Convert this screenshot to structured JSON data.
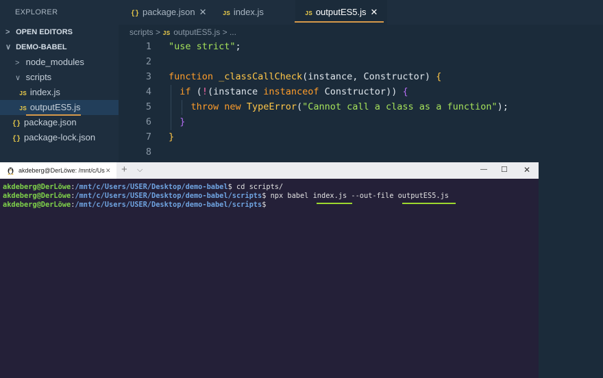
{
  "explorer": {
    "title": "EXPLORER",
    "open_editors": "OPEN EDITORS",
    "project": "DEMO-BABEL",
    "items": [
      {
        "label": "node_modules",
        "icon": "chevron-right-icon"
      },
      {
        "label": "scripts",
        "icon": "chevron-down-icon"
      },
      {
        "label": "index.js",
        "icon": "js-file-icon"
      },
      {
        "label": "outputES5.js",
        "icon": "js-file-icon"
      },
      {
        "label": "package.json",
        "icon": "json-file-icon"
      },
      {
        "label": "package-lock.json",
        "icon": "json-file-icon"
      }
    ]
  },
  "tabs": [
    {
      "label": "package.json",
      "icon": "json-file-icon",
      "close": "✕"
    },
    {
      "label": "index.js",
      "icon": "js-file-icon"
    },
    {
      "label": "outputES5.js",
      "icon": "js-file-icon",
      "close": "✕"
    }
  ],
  "icons": {
    "js": "JS",
    "json": "{}"
  },
  "breadcrumb": {
    "folder": "scripts",
    "sep": ">",
    "file": "outputES5.js",
    "more": "..."
  },
  "editor": {
    "line_numbers": [
      "1",
      "2",
      "3",
      "4",
      "5",
      "6",
      "7",
      "8"
    ],
    "l1_str": "\"use strict\"",
    "l1_semi": ";",
    "l3_kw": "function",
    "l3_name": "_classCallCheck",
    "l3_open": "(",
    "l3_params": "instance, Constructor",
    "l3_close": ")",
    "l3_brace": "{",
    "l4_kw": "if",
    "l4_a": "(",
    "l4_not": "!",
    "l4_b": "(instance ",
    "l4_op": "instanceof",
    "l4_c": " Constructor",
    "l4_d": "))",
    "l4_brace": "{",
    "l5_kw": "throw",
    "l5_new": "new",
    "l5_cls": "TypeError",
    "l5_a": "(",
    "l5_str": "\"Cannot call a class as a function\"",
    "l5_b": ");",
    "l6": "}",
    "l7": "}"
  },
  "terminal": {
    "tab_title": "akdeberg@DerLöwe: /mnt/c/Us",
    "tab_close": "✕",
    "new_tab": "+",
    "dropdown": "⌵",
    "minimize": "—",
    "maximize": "☐",
    "close": "✕",
    "user": "akdeberg@DerLöwe",
    "colon": ":",
    "path1": "/mnt/c/Users/USER/Desktop/demo-babel",
    "prompt": "$",
    "cmd1": " cd scripts/",
    "path2": "/mnt/c/Users/USER/Desktop/demo-babel/scripts",
    "cmd2_a": " npx babel ",
    "cmd2_in": "index.js",
    "cmd2_b": " --out-file ",
    "cmd2_out": "outputES5.js",
    "path3": "/mnt/c/Users/USER/Desktop/demo-babel/scripts"
  },
  "colors": {
    "accent": "#d89a4a",
    "highlight": "#9ed92e"
  }
}
